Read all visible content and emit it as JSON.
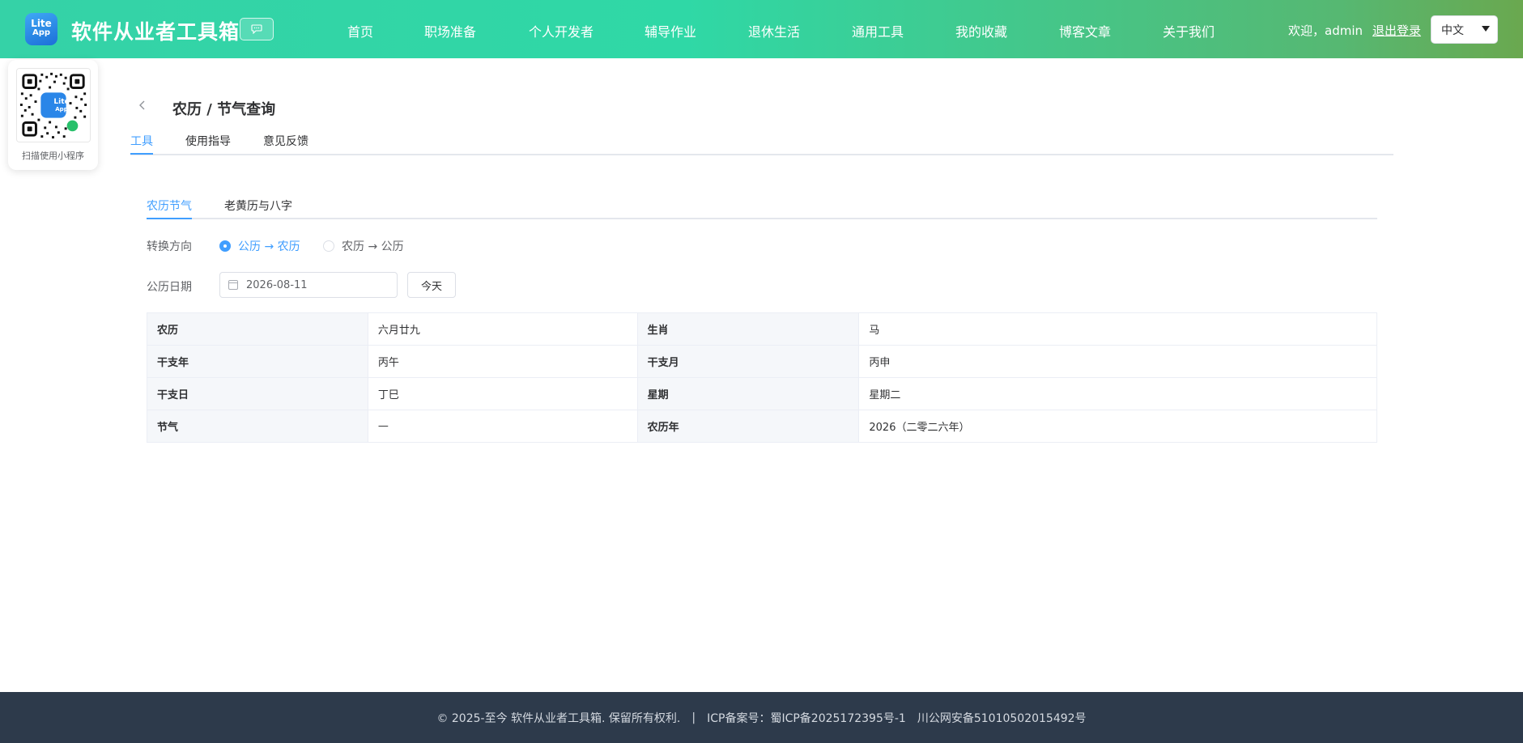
{
  "header": {
    "logo_top": "Lite",
    "logo_bottom": "App",
    "site_title": "软件从业者工具箱",
    "nav": [
      "首页",
      "职场准备",
      "个人开发者",
      "辅导作业",
      "退休生活",
      "通用工具",
      "我的收藏",
      "博客文章",
      "关于我们"
    ],
    "welcome": "欢迎，admin",
    "logout": "退出登录",
    "language": "中文"
  },
  "qr": {
    "label": "扫描使用小程序",
    "logo_top": "Lite",
    "logo_bottom": "App"
  },
  "page": {
    "title": "农历 / 节气查询",
    "tabs": [
      "工具",
      "使用指导",
      "意见反馈"
    ],
    "active_tab": "工具"
  },
  "tool": {
    "tabs": [
      "农历节气",
      "老黄历与八字"
    ],
    "direction_label": "转换方向",
    "direction_options": [
      "公历 → 农历",
      "农历 → 公历"
    ],
    "selected_direction": "公历 → 农历",
    "date_label": "公历日期",
    "date_value": "2026-08-11",
    "today_button": "今天",
    "result": [
      [
        "农历",
        "六月廿九",
        "生肖",
        "马"
      ],
      [
        "干支年",
        "丙午",
        "干支月",
        "丙申"
      ],
      [
        "干支日",
        "丁巳",
        "星期",
        "星期二"
      ],
      [
        "节气",
        "—",
        "农历年",
        "2026（二零二六年）"
      ]
    ]
  },
  "footer": {
    "copyright": "© 2025-至今 软件从业者工具箱. 保留所有权利.",
    "separator": "|",
    "icp": "ICP备案号：蜀ICP备2025172395号-1",
    "police": "川公网安备51010502015492号"
  },
  "colors": {
    "header_gradient_start": "#35d2a7",
    "header_gradient_end": "#6aa84f",
    "accent": "#409eff",
    "footer_bg": "#2d3a4b"
  }
}
